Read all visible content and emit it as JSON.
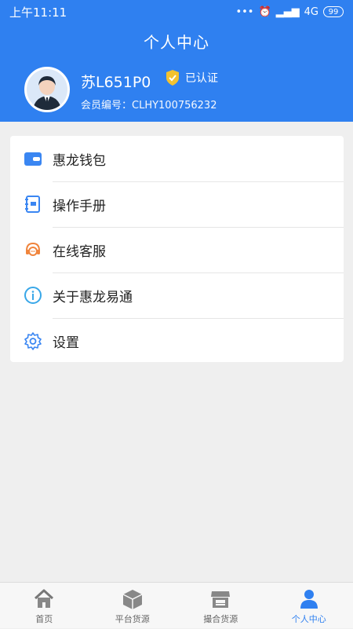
{
  "status": {
    "time": "上午11:11",
    "network": "4G",
    "battery": "99"
  },
  "header": {
    "title": "个人中心",
    "username": "苏L651P0",
    "verified_label": "已认证",
    "member_id": "会员编号：CLHY100756232"
  },
  "menu": {
    "items": [
      {
        "label": "惠龙钱包",
        "icon": "wallet-icon"
      },
      {
        "label": "操作手册",
        "icon": "manual-icon"
      },
      {
        "label": "在线客服",
        "icon": "customer-service-icon"
      },
      {
        "label": "关于惠龙易通",
        "icon": "info-icon"
      },
      {
        "label": "设置",
        "icon": "gear-icon"
      }
    ]
  },
  "bottom_nav": {
    "items": [
      {
        "label": "首页",
        "icon": "home-icon"
      },
      {
        "label": "平台货源",
        "icon": "box-icon"
      },
      {
        "label": "撮合货源",
        "icon": "store-icon"
      },
      {
        "label": "个人中心",
        "icon": "user-icon"
      }
    ],
    "active_index": 3
  },
  "colors": {
    "primary": "#2f80f0",
    "background": "#efefef"
  }
}
